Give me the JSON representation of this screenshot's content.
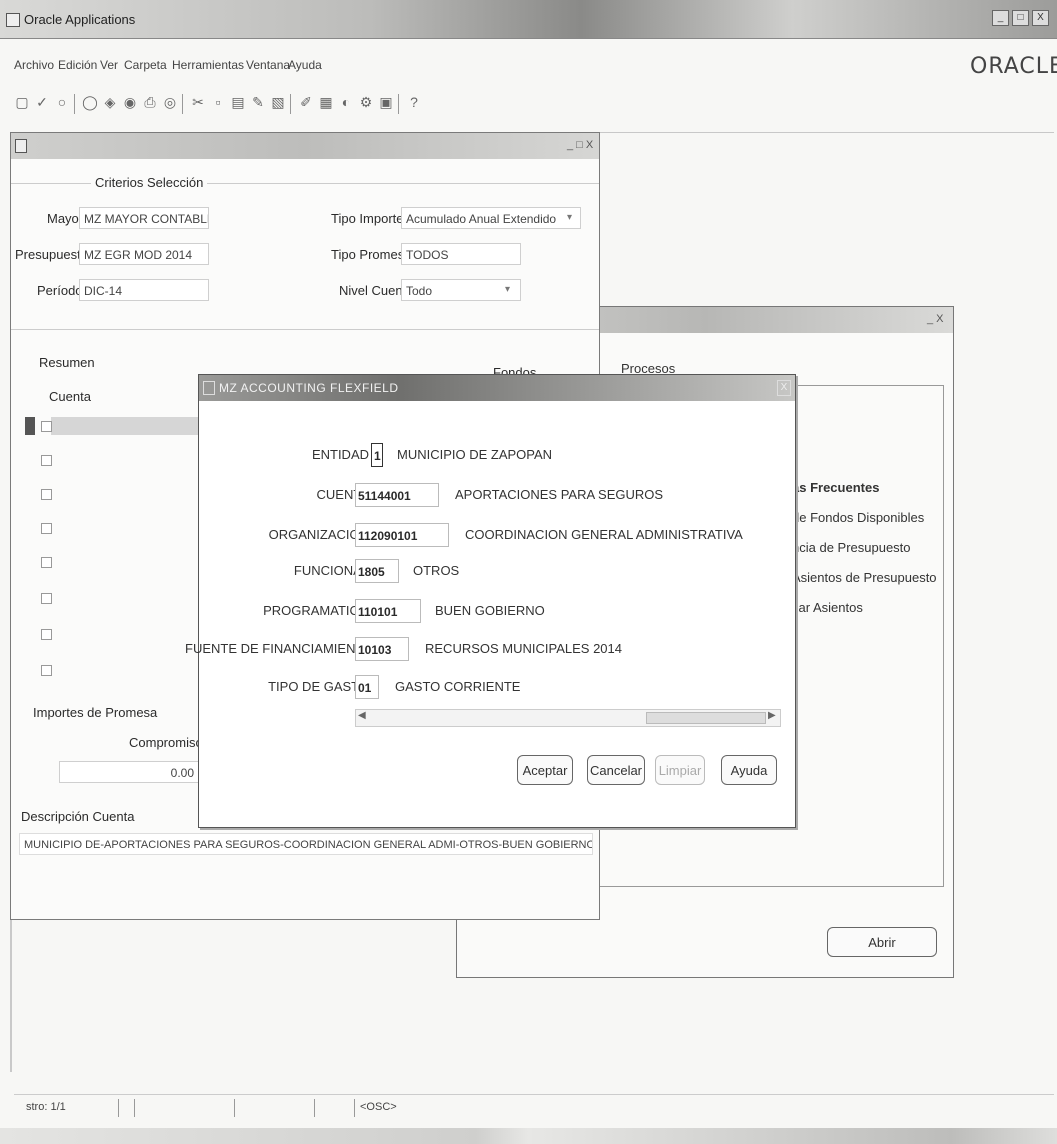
{
  "app": {
    "title": "Oracle Applications",
    "logo": "ORACLE",
    "menu": [
      "Archivo",
      "Edición",
      "Ver",
      "Carpeta",
      "Herramientas",
      "Ventana",
      "Ayuda"
    ],
    "window_buttons": [
      "_",
      "□",
      "X"
    ]
  },
  "main_window": {
    "criteria_header": "Criterios Selección",
    "mayor_label": "Mayor",
    "mayor_value": "MZ MAYOR CONTABLE",
    "presupuesto_label": "Presupuesto",
    "presupuesto_value": "MZ EGR MOD 2014",
    "periodo_label": "Período",
    "periodo_value": "DIC-14",
    "tipo_importe_label": "Tipo Importe",
    "tipo_importe_value": "Acumulado Anual Extendido",
    "tipo_promesa_label": "Tipo Promesa",
    "tipo_promesa_value": "TODOS",
    "nivel_cuenta_label": "Nivel Cuenta",
    "nivel_cuenta_value": "Todo",
    "resumen_label": "Resumen",
    "cuenta_header": "Cuenta",
    "fondos_label": "Fondos",
    "importes_label": "Importes de Promesa",
    "compromiso_label": "Compromiso",
    "compromiso_value": "0.00",
    "descripcion_label": "Descripción Cuenta",
    "descripcion_value": "MUNICIPIO DE-APORTACIONES PARA SEGUROS-COORDINACION GENERAL ADMI-OTROS-BUEN GOBIERNO-RECURS"
  },
  "back_window": {
    "procesos_label": "Procesos",
    "frecuentes_header": "as Frecuentes",
    "items": [
      "de Fondos Disponibles",
      "ncia de Presupuesto",
      "Asientos de Presupuesto",
      "zar Asientos"
    ],
    "abrir_button": "Abrir"
  },
  "modal": {
    "title": "MZ ACCOUNTING FLEXFIELD",
    "rows": [
      {
        "label": "ENTIDAD",
        "code": "1",
        "desc": "MUNICIPIO DE ZAPOPAN"
      },
      {
        "label": "CUENTA",
        "code": "51144001",
        "desc": "APORTACIONES PARA SEGUROS"
      },
      {
        "label": "ORGANIZACION",
        "code": "112090101",
        "desc": "COORDINACION GENERAL ADMINISTRATIVA"
      },
      {
        "label": "FUNCIONAL",
        "code": "1805",
        "desc": "OTROS"
      },
      {
        "label": "PROGRAMATICO",
        "code": "110101",
        "desc": "BUEN GOBIERNO"
      },
      {
        "label": "FUENTE DE FINANCIAMIENTO",
        "code": "10103",
        "desc": "RECURSOS MUNICIPALES 2014"
      },
      {
        "label": "TIPO DE GASTO",
        "code": "01",
        "desc": "GASTO CORRIENTE"
      }
    ],
    "buttons": {
      "ok": "Aceptar",
      "cancel": "Cancelar",
      "clear": "Limpiar",
      "help": "Ayuda"
    }
  },
  "status": {
    "record": "stro: 1/1",
    "osc": "<OSC>"
  }
}
